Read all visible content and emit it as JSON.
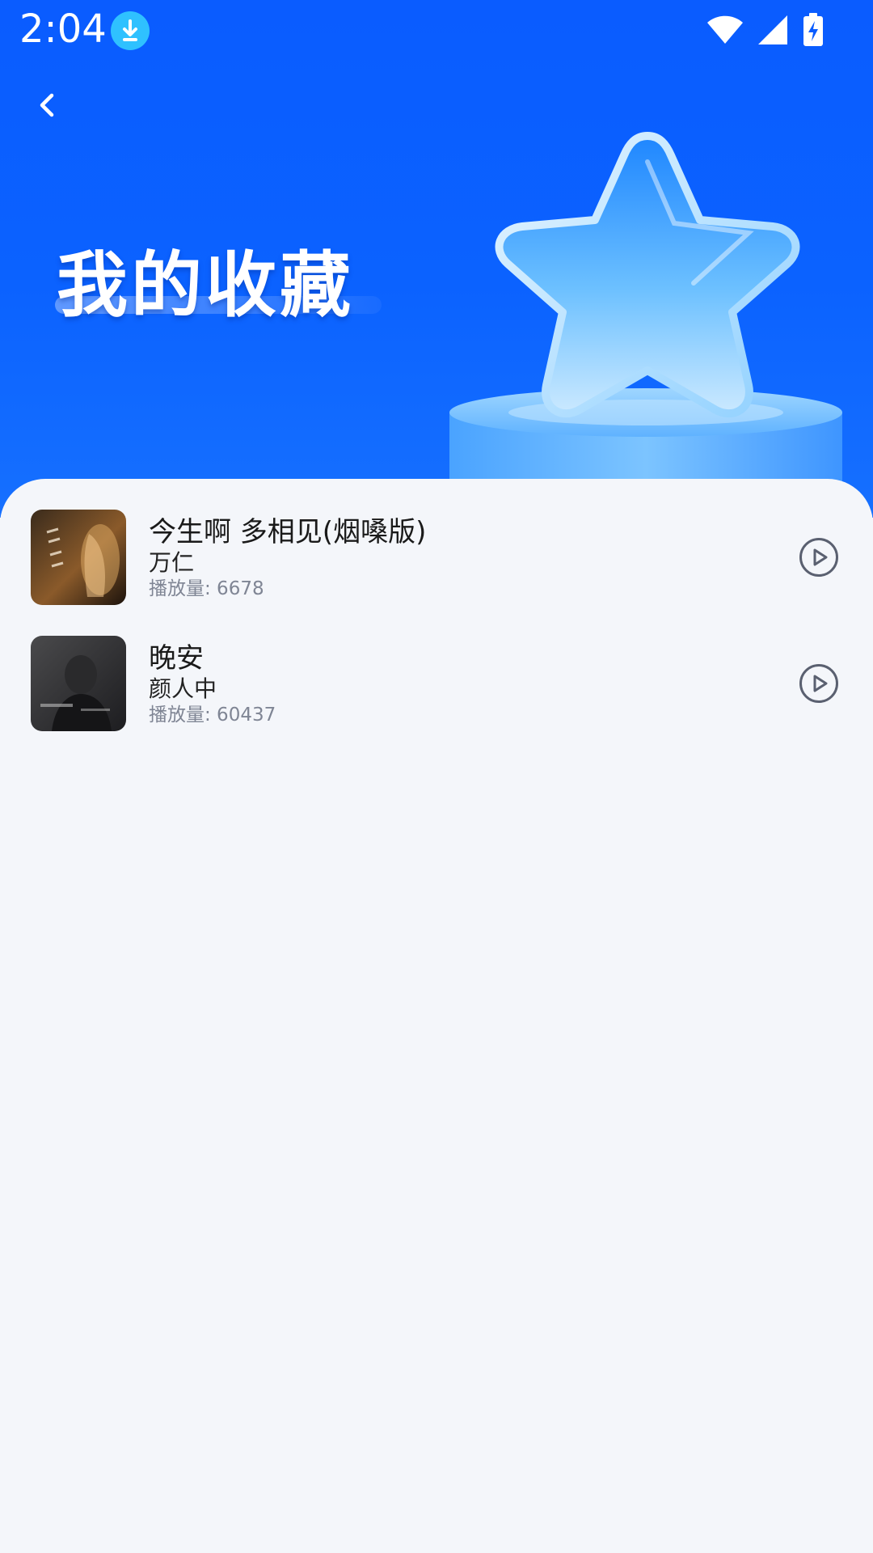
{
  "status_bar": {
    "time": "2:04",
    "download_icon": "download-circle-icon",
    "wifi_icon": "wifi-icon",
    "signal_icon": "cell-signal-icon",
    "battery_icon": "battery-charging-icon"
  },
  "header": {
    "back_icon": "chevron-left-icon",
    "title": "我的收藏",
    "illustration": "star-on-pedestal",
    "background_color": "#0a5cff"
  },
  "favorites": [
    {
      "title": "今生啊 多相见(烟嗓版)",
      "artist": "万仁",
      "plays_label": "播放量: 6678",
      "cover_icon": "album-cover",
      "play_icon": "play-circle-icon"
    },
    {
      "title": "晚安",
      "artist": "颜人中",
      "plays_label": "播放量: 60437",
      "cover_icon": "album-cover",
      "play_icon": "play-circle-icon"
    }
  ]
}
